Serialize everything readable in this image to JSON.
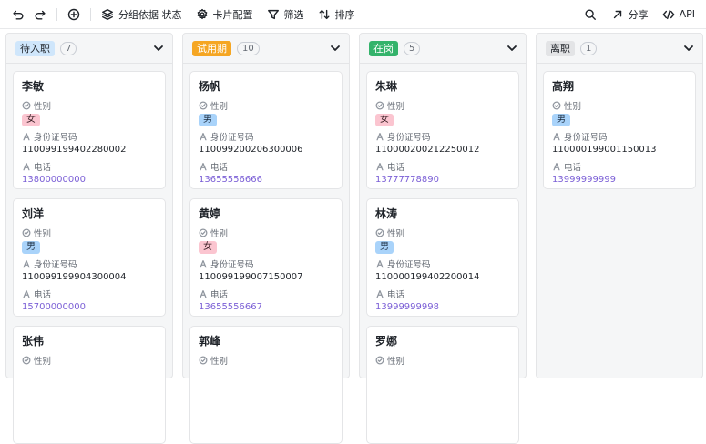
{
  "toolbar": {
    "group_label": "分组依据 状态",
    "card_config_label": "卡片配置",
    "filter_label": "筛选",
    "sort_label": "排序",
    "share_label": "分享",
    "api_label": "API"
  },
  "field_labels": {
    "gender": "性别",
    "id": "身份证号码",
    "phone": "电话"
  },
  "columns": [
    {
      "status": "待入职",
      "count": "7",
      "tag_bg": "#cfe6fb",
      "tag_fg": "#1f2329",
      "cards": [
        {
          "name": "李敏",
          "gender": "女",
          "gender_type": "female",
          "id": "110099199402280002",
          "phone": "13800000000"
        },
        {
          "name": "刘洋",
          "gender": "男",
          "gender_type": "male",
          "id": "110099199904300004",
          "phone": "15700000000"
        },
        {
          "name": "张伟",
          "gender_label_only": true
        }
      ]
    },
    {
      "status": "试用期",
      "count": "10",
      "tag_bg": "#f5a623",
      "tag_fg": "#ffffff",
      "cards": [
        {
          "name": "杨帆",
          "gender": "男",
          "gender_type": "male",
          "id": "110099200206300006",
          "phone": "13655556666"
        },
        {
          "name": "黄婷",
          "gender": "女",
          "gender_type": "female",
          "id": "110099199007150007",
          "phone": "13655556667"
        },
        {
          "name": "郭峰",
          "gender_label_only": true
        }
      ]
    },
    {
      "status": "在岗",
      "count": "5",
      "tag_bg": "#34b36b",
      "tag_fg": "#ffffff",
      "cards": [
        {
          "name": "朱琳",
          "gender": "女",
          "gender_type": "female",
          "id": "110000200212250012",
          "phone": "13777778890"
        },
        {
          "name": "林涛",
          "gender": "男",
          "gender_type": "male",
          "id": "110000199402200014",
          "phone": "13999999998"
        },
        {
          "name": "罗娜",
          "gender_label_only": true
        }
      ]
    },
    {
      "status": "离职",
      "count": "1",
      "tag_bg": "#e3e4e6",
      "tag_fg": "#1f2329",
      "cards": [
        {
          "name": "高翔",
          "gender": "男",
          "gender_type": "male",
          "id": "110000199001150013",
          "phone": "13999999999"
        }
      ]
    }
  ]
}
